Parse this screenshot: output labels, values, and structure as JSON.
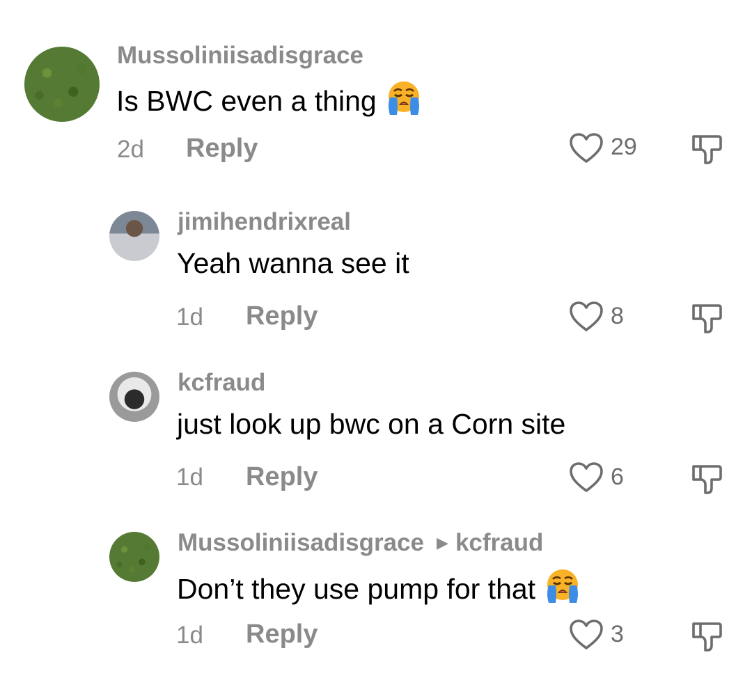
{
  "comments": [
    {
      "username": "Mussoliniisadisgrace",
      "text": "Is BWC even a thing",
      "emoji": "loudly-crying-face",
      "time": "2d",
      "reply_label": "Reply",
      "likes": "29"
    },
    {
      "username": "jimihendrixreal",
      "text": "Yeah wanna see it",
      "time": "1d",
      "reply_label": "Reply",
      "likes": "8"
    },
    {
      "username": "kcfraud",
      "text": "just look up bwc on a Corn site",
      "time": "1d",
      "reply_label": "Reply",
      "likes": "6"
    },
    {
      "username": "Mussoliniisadisgrace",
      "reply_to": "kcfraud",
      "text": "Don’t they use pump for that",
      "emoji": "loudly-crying-face",
      "time": "1d",
      "reply_label": "Reply",
      "likes": "3"
    }
  ],
  "icons": {
    "like": "heart-outline-icon",
    "dislike": "thumbs-down-icon",
    "reply_arrow": "triangle-right-icon"
  },
  "colors": {
    "username": "#8a8a8a",
    "meta": "#8a8a8a",
    "text": "#000000",
    "emoji_face": "#f9b227",
    "emoji_tears": "#3d8de6"
  }
}
